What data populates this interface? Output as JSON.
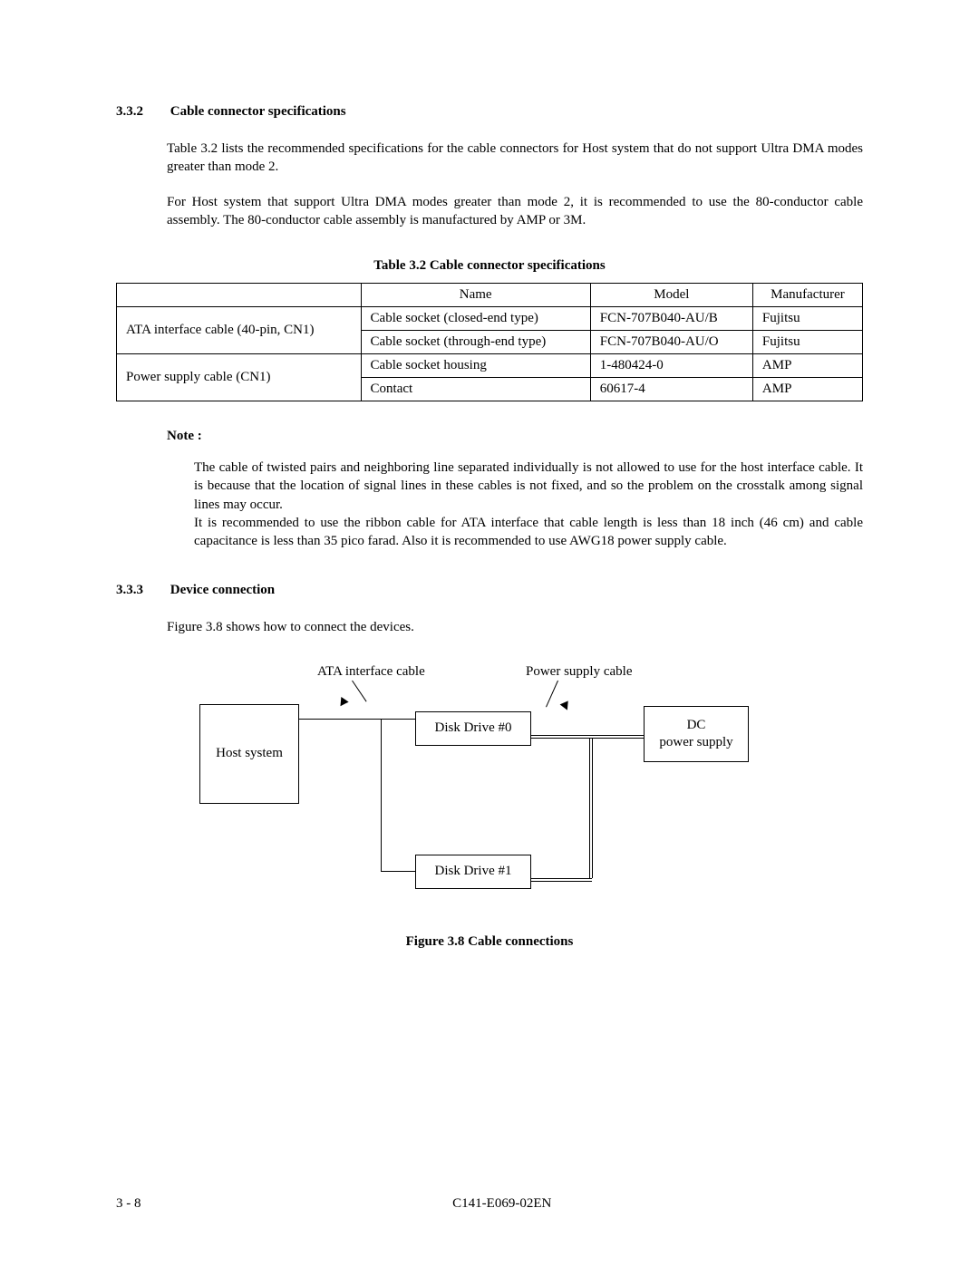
{
  "section1": {
    "num": "3.3.2",
    "title": "Cable connector specifications",
    "para1": "Table 3.2 lists the recommended specifications for the cable connectors for Host system that do not support Ultra DMA modes greater than mode 2.",
    "para2": "For Host system that support Ultra DMA modes greater than mode 2, it is recommended to use the 80-conductor cable assembly.  The 80-conductor cable assembly is manufactured by AMP or 3M."
  },
  "table": {
    "caption": "Table 3.2    Cable connector specifications",
    "headers": {
      "name": "Name",
      "model": "Model",
      "mfr": "Manufacturer"
    },
    "rows": [
      {
        "rowlabel": "ATA interface cable (40-pin, CN1)",
        "rowspan": 2,
        "name": "Cable socket (closed-end type)",
        "model": "FCN-707B040-AU/B",
        "mfr": "Fujitsu"
      },
      {
        "name": "Cable socket (through-end type)",
        "model": "FCN-707B040-AU/O",
        "mfr": "Fujitsu"
      },
      {
        "rowlabel": "Power supply cable (CN1)",
        "rowspan": 2,
        "name": "Cable socket housing",
        "model": "1-480424-0",
        "mfr": "AMP"
      },
      {
        "name": "Contact",
        "model": "60617-4",
        "mfr": "AMP"
      }
    ]
  },
  "note": {
    "label": "Note :",
    "body1": "The cable of twisted pairs and neighboring line separated individually is not allowed to use for the host interface cable.  It is because that the location of signal lines in these cables is not fixed, and so the problem on the crosstalk among signal lines may occur.",
    "body2": "It is recommended to use the ribbon cable for ATA interface that cable length is less than 18 inch (46 cm) and cable capacitance is less than 35 pico farad.  Also it is recommended to use AWG18 power supply cable."
  },
  "section2": {
    "num": "3.3.3",
    "title": "Device connection",
    "para": "Figure 3.8 shows how to connect the devices."
  },
  "diagram": {
    "label_ata": "ATA interface cable",
    "label_power": "Power supply cable",
    "host": "Host system",
    "dd0": "Disk Drive #0",
    "dd1": "Disk Drive #1",
    "dc_line1": "DC",
    "dc_line2": "power supply",
    "caption": "Figure 3.8    Cable connections"
  },
  "footer": {
    "page": "3 - 8",
    "docid": "C141-E069-02EN"
  }
}
